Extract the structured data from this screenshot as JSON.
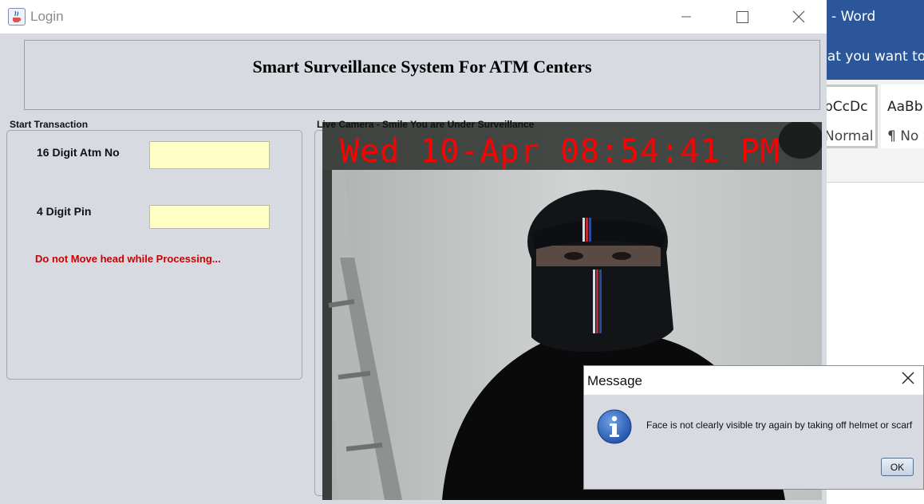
{
  "word_window": {
    "title": "]  -  Word",
    "tell_me": "hat you want to",
    "styles": [
      {
        "preview": "bCcDc",
        "name": "Normal"
      },
      {
        "preview": "AaBb",
        "name": "¶ No S"
      }
    ]
  },
  "login_window": {
    "title": "Login",
    "app_title": "Smart Surveillance System For ATM Centers",
    "transaction": {
      "group_label": "Start Transaction",
      "atm_label": "16 Digit Atm No",
      "atm_value": "",
      "pin_label": "4 Digit Pin",
      "pin_value": "",
      "warning": "Do not Move head while Processing...",
      "warning_color": "#cc0000"
    },
    "camera": {
      "group_label": "Live Camera - Smile You are Under Surveillance",
      "timestamp": "Wed 10-Apr 08:54:41 PM",
      "timestamp_color": "#ff0000"
    }
  },
  "message_dialog": {
    "title": "Message",
    "text": "Face is not clearly visible try again by taking off helmet or scarf",
    "icon": "info-icon",
    "ok_label": "OK"
  }
}
